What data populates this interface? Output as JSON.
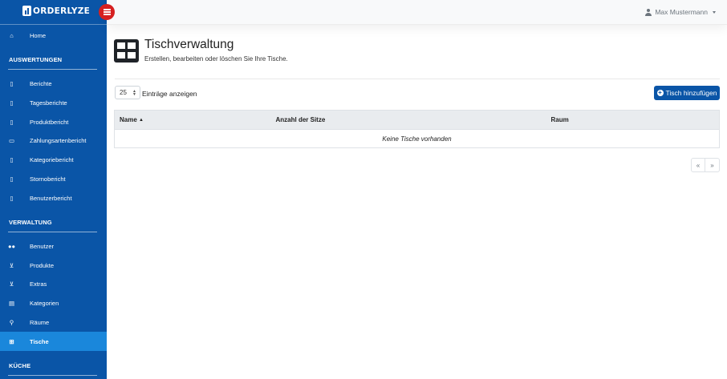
{
  "brand": {
    "name": "ORDERLYZE"
  },
  "user": {
    "name": "Max Mustermann"
  },
  "nav": {
    "home": "Home",
    "section_auswertungen": "AUSWERTUNGEN",
    "berichte": "Berichte",
    "tagesberichte": "Tagesberichte",
    "produktbericht": "Produktbericht",
    "zahlungsartenbericht": "Zahlungsartenbericht",
    "kategoriebericht": "Kategoriebericht",
    "stornobericht": "Stornobericht",
    "benutzerbericht": "Benutzerbericht",
    "section_verwaltung": "VERWALTUNG",
    "benutzer": "Benutzer",
    "produkte": "Produkte",
    "extras": "Extras",
    "kategorien": "Kategorien",
    "raeume": "Räume",
    "tische": "Tische",
    "section_kueche": "KÜCHE"
  },
  "page": {
    "title": "Tischverwaltung",
    "subtitle": "Erstellen, bearbeiten oder löschen Sie Ihre Tische."
  },
  "controls": {
    "page_length": "25",
    "page_length_label": "Einträge anzeigen",
    "add_button": "Tisch hinzufügen"
  },
  "table": {
    "columns": [
      "Name",
      "Anzahl der Sitze",
      "Raum"
    ],
    "empty_message": "Keine Tische vorhanden"
  },
  "pagination": {
    "prev": "«",
    "next": "»"
  },
  "colors": {
    "sidebar": "#0a55a7",
    "active": "#1a87db",
    "menu_button": "#d62020"
  }
}
